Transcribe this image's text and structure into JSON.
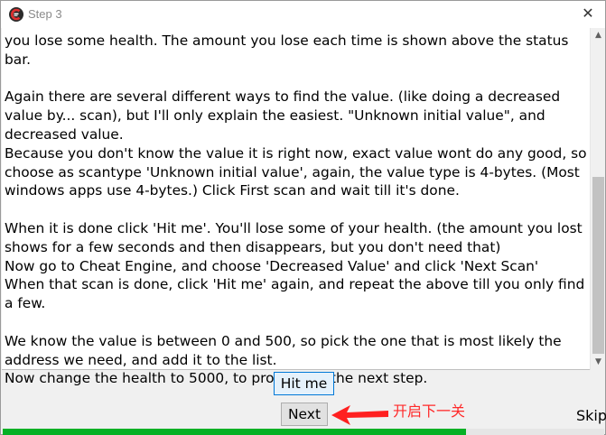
{
  "window": {
    "title": "Step 3",
    "close_glyph": "✕",
    "icon": "cheat-engine-logo-icon"
  },
  "tutorial": {
    "text": "you lose some health. The amount you lose each time is shown above the status bar.\n\nAgain there are several different ways to find the value. (like doing a decreased value by... scan), but I'll only explain the easiest. \"Unknown initial value\", and decreased value.\nBecause you don't know the value it is right now, exact value wont do any good, so choose as scantype 'Unknown initial value', again, the value type is 4-bytes. (Most windows apps use 4-bytes.) Click First scan and wait till it's done.\n\nWhen it is done click 'Hit me'. You'll lose some of your health. (the amount you lost shows for a few seconds and then disappears, but you don't need that)\nNow go to Cheat Engine, and choose 'Decreased Value' and click 'Next Scan'\nWhen that scan is done, click 'Hit me' again, and repeat the above till you only find a few.\n\nWe know the value is between 0 and 500, so pick the one that is most likely the address we need, and add it to the list.\nNow change the health to 5000, to proceed to the next step."
  },
  "scrollbar": {
    "up_glyph": "▲",
    "down_glyph": "▼"
  },
  "buttons": {
    "hit_me": "Hit me",
    "next": "Next",
    "skip": "Skip"
  },
  "annotation": {
    "text": "开启下一关",
    "color": "#ff2a2a"
  },
  "health_bar": {
    "percent": 77,
    "color": "#06b025"
  }
}
